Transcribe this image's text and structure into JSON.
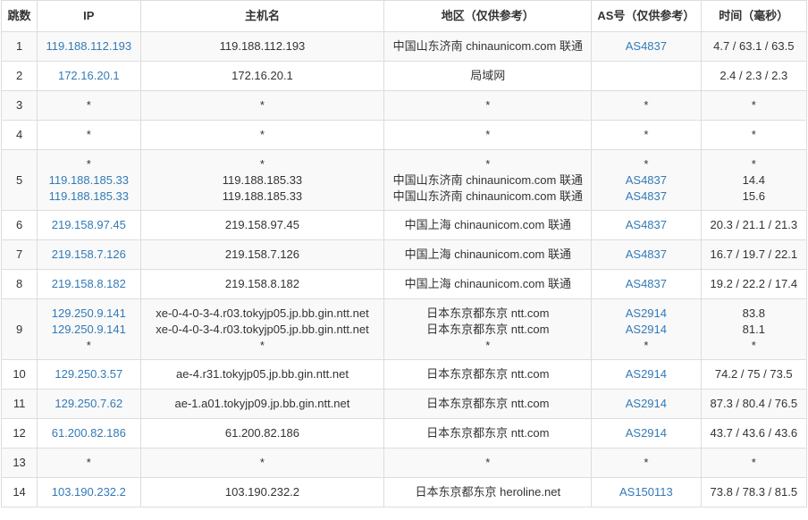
{
  "header": {
    "hop": "跳数",
    "ip": "IP",
    "host": "主机名",
    "geo": "地区（仅供参考）",
    "as": "AS号（仅供参考）",
    "time": "时间（毫秒）"
  },
  "rows": [
    {
      "hop": "1",
      "ip": [
        "119.188.112.193"
      ],
      "host": [
        "119.188.112.193"
      ],
      "geo": [
        "中国山东济南 chinaunicom.com 联通"
      ],
      "as": [
        "AS4837"
      ],
      "time": [
        "4.7 / 63.1 / 63.5"
      ]
    },
    {
      "hop": "2",
      "ip": [
        "172.16.20.1"
      ],
      "host": [
        "172.16.20.1"
      ],
      "geo": [
        "局域网"
      ],
      "as": [
        ""
      ],
      "time": [
        "2.4 / 2.3 / 2.3"
      ]
    },
    {
      "hop": "3",
      "ip": [
        "*"
      ],
      "host": [
        "*"
      ],
      "geo": [
        "*"
      ],
      "as": [
        "*"
      ],
      "time": [
        "*"
      ]
    },
    {
      "hop": "4",
      "ip": [
        "*"
      ],
      "host": [
        "*"
      ],
      "geo": [
        "*"
      ],
      "as": [
        "*"
      ],
      "time": [
        "*"
      ]
    },
    {
      "hop": "5",
      "ip": [
        "*",
        "119.188.185.33",
        "119.188.185.33"
      ],
      "host": [
        "*",
        "119.188.185.33",
        "119.188.185.33"
      ],
      "geo": [
        "*",
        "中国山东济南 chinaunicom.com 联通",
        "中国山东济南 chinaunicom.com 联通"
      ],
      "as": [
        "*",
        "AS4837",
        "AS4837"
      ],
      "time": [
        "*",
        "14.4",
        "15.6"
      ]
    },
    {
      "hop": "6",
      "ip": [
        "219.158.97.45"
      ],
      "host": [
        "219.158.97.45"
      ],
      "geo": [
        "中国上海 chinaunicom.com 联通"
      ],
      "as": [
        "AS4837"
      ],
      "time": [
        "20.3 / 21.1 / 21.3"
      ]
    },
    {
      "hop": "7",
      "ip": [
        "219.158.7.126"
      ],
      "host": [
        "219.158.7.126"
      ],
      "geo": [
        "中国上海 chinaunicom.com 联通"
      ],
      "as": [
        "AS4837"
      ],
      "time": [
        "16.7 / 19.7 / 22.1"
      ]
    },
    {
      "hop": "8",
      "ip": [
        "219.158.8.182"
      ],
      "host": [
        "219.158.8.182"
      ],
      "geo": [
        "中国上海 chinaunicom.com 联通"
      ],
      "as": [
        "AS4837"
      ],
      "time": [
        "19.2 / 22.2 / 17.4"
      ]
    },
    {
      "hop": "9",
      "ip": [
        "129.250.9.141",
        "129.250.9.141",
        "*"
      ],
      "host": [
        "xe-0-4-0-3-4.r03.tokyjp05.jp.bb.gin.ntt.net",
        "xe-0-4-0-3-4.r03.tokyjp05.jp.bb.gin.ntt.net",
        "*"
      ],
      "geo": [
        "日本东京都东京 ntt.com",
        "日本东京都东京 ntt.com",
        "*"
      ],
      "as": [
        "AS2914",
        "AS2914",
        "*"
      ],
      "time": [
        "83.8",
        "81.1",
        "*"
      ]
    },
    {
      "hop": "10",
      "ip": [
        "129.250.3.57"
      ],
      "host": [
        "ae-4.r31.tokyjp05.jp.bb.gin.ntt.net"
      ],
      "geo": [
        "日本东京都东京 ntt.com"
      ],
      "as": [
        "AS2914"
      ],
      "time": [
        "74.2 / 75 / 73.5"
      ]
    },
    {
      "hop": "11",
      "ip": [
        "129.250.7.62"
      ],
      "host": [
        "ae-1.a01.tokyjp09.jp.bb.gin.ntt.net"
      ],
      "geo": [
        "日本东京都东京 ntt.com"
      ],
      "as": [
        "AS2914"
      ],
      "time": [
        "87.3 / 80.4 / 76.5"
      ]
    },
    {
      "hop": "12",
      "ip": [
        "61.200.82.186"
      ],
      "host": [
        "61.200.82.186"
      ],
      "geo": [
        "日本东京都东京 ntt.com"
      ],
      "as": [
        "AS2914"
      ],
      "time": [
        "43.7 / 43.6 / 43.6"
      ]
    },
    {
      "hop": "13",
      "ip": [
        "*"
      ],
      "host": [
        "*"
      ],
      "geo": [
        "*"
      ],
      "as": [
        "*"
      ],
      "time": [
        "*"
      ]
    },
    {
      "hop": "14",
      "ip": [
        "103.190.232.2"
      ],
      "host": [
        "103.190.232.2"
      ],
      "geo": [
        "日本东京都东京 heroline.net"
      ],
      "as": [
        "AS150113"
      ],
      "time": [
        "73.8 / 78.3 / 81.5"
      ]
    }
  ],
  "colors": {
    "link": "#337ab7",
    "border": "#dddddd",
    "stripe": "#f9f9f9",
    "text": "#333333"
  }
}
